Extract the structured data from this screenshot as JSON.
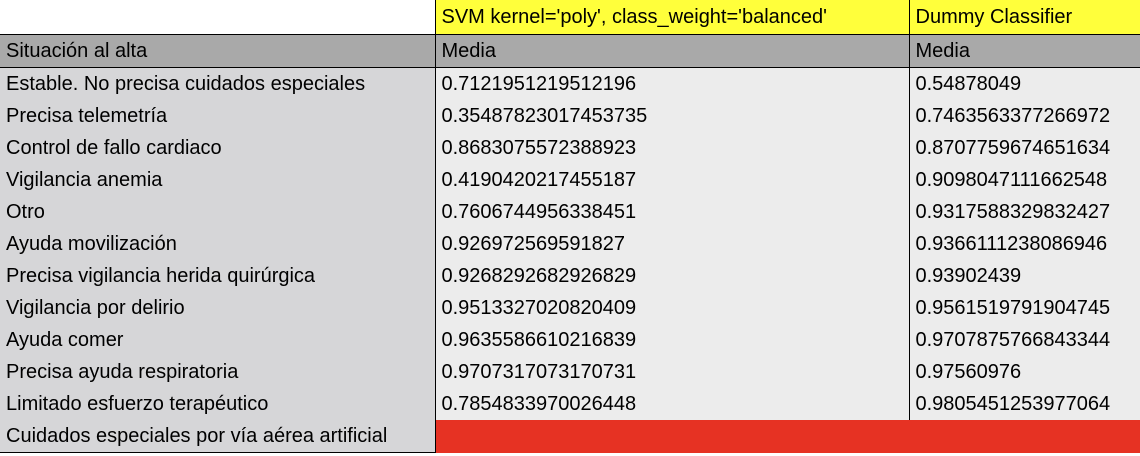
{
  "header": {
    "svm_title": "SVM kernel='poly', class_weight='balanced'",
    "dummy_title": "Dummy Classifier"
  },
  "subheader": {
    "label": "Situación al alta",
    "svm_metric": "Media",
    "dummy_metric": "Media"
  },
  "rows": [
    {
      "label": "Estable. No precisa cuidados especiales",
      "svm": "0.7121951219512196",
      "dummy": "0.54878049"
    },
    {
      "label": "Precisa telemetría",
      "svm": "0.35487823017453735",
      "dummy": "0.7463563377266972"
    },
    {
      "label": "Control de fallo cardiaco",
      "svm": "0.8683075572388923",
      "dummy": "0.8707759674651634"
    },
    {
      "label": "Vigilancia anemia",
      "svm": "0.4190420217455187",
      "dummy": "0.9098047111662548"
    },
    {
      "label": "Otro",
      "svm": "0.7606744956338451",
      "dummy": "0.9317588329832427"
    },
    {
      "label": "Ayuda movilización",
      "svm": "0.926972569591827",
      "dummy": "0.9366111238086946"
    },
    {
      "label": "Precisa vigilancia herida quirúrgica",
      "svm": "0.9268292682926829",
      "dummy": "0.93902439"
    },
    {
      "label": "Vigilancia por delirio",
      "svm": "0.9513327020820409",
      "dummy": "0.9561519791904745"
    },
    {
      "label": "Ayuda comer",
      "svm": "0.9635586610216839",
      "dummy": "0.9707875766843344"
    },
    {
      "label": "Precisa ayuda respiratoria",
      "svm": "0.9707317073170731",
      "dummy": "0.97560976"
    },
    {
      "label": "Limitado esfuerzo terapéutico",
      "svm": "0.7854833970026448",
      "dummy": "0.9805451253977064"
    }
  ],
  "last_row": {
    "label": "Cuidados especiales por vía aérea artificial",
    "highlight_color": "#e63223"
  },
  "colors": {
    "header_yellow": "#ffff3b",
    "subheader_gray": "#a9a9a9",
    "label_gray": "#d6d6d8",
    "value_gray": "#ececec"
  }
}
